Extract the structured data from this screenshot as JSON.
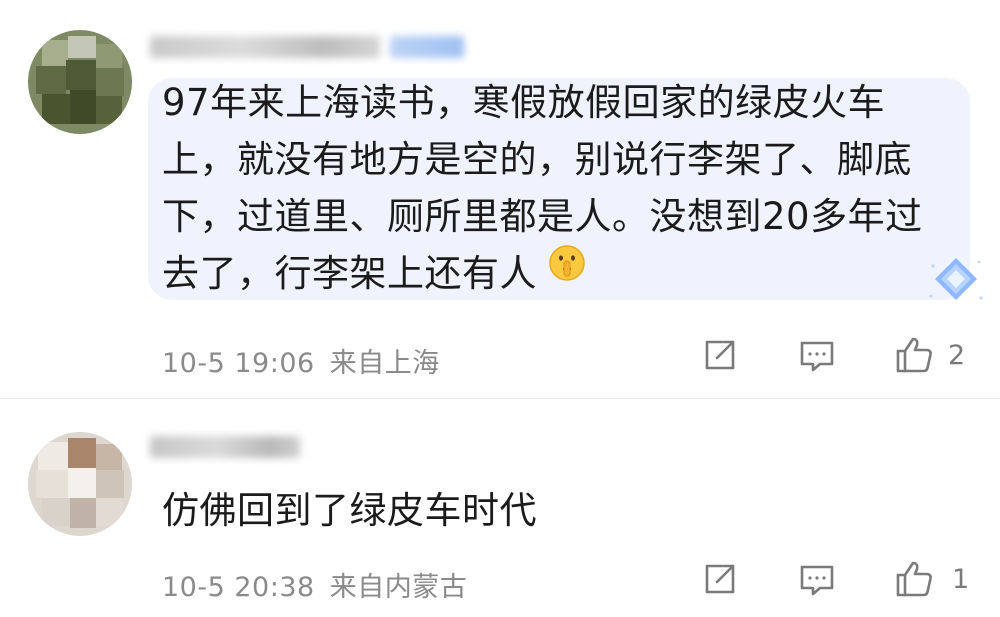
{
  "comments": [
    {
      "text_lines": [
        "97年来上海读书，寒假放假回家的绿皮火车",
        "上，就没有地方是空的，别说行李架了、脚底",
        "下，过道里、厕所里都是人。没想到20多年过",
        "去了，行李架上还有人"
      ],
      "emoji_icon": "shushing-face-emoji",
      "time": "10-5 19:06",
      "location": "来自上海",
      "likes": "2"
    },
    {
      "text_lines": [
        "仿佛回到了绿皮车时代"
      ],
      "time": "10-5 20:38",
      "location": "来自内蒙古",
      "likes": "1"
    }
  ],
  "icons": {
    "share": "share-icon",
    "reply": "reply-comment-icon",
    "like": "thumbs-up-icon",
    "badge": "diamond-badge-icon"
  },
  "colors": {
    "bubble_bg": "#eef3fd",
    "text": "#1b1b1b",
    "meta": "#8a8a8a",
    "icon": "#7a7a7a"
  }
}
